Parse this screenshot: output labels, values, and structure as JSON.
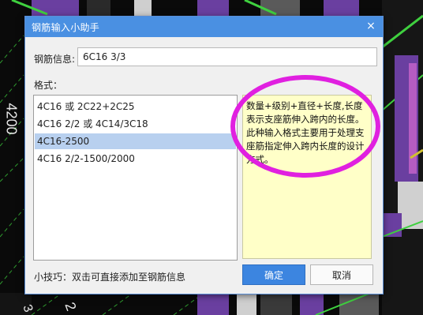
{
  "background": {
    "labels": [
      "4200",
      "2",
      "3"
    ]
  },
  "dialog": {
    "title": "钢筋输入小助手",
    "close_glyph": "×",
    "info_label": "钢筋信息:",
    "info_value": "6C16 3/3",
    "format_label": "格式：",
    "formats": [
      "4C16 或 2C22+2C25",
      "4C16 2/2 或 4C14/3C18",
      "4C16-2500",
      "4C16 2/2-1500/2000"
    ],
    "selected_index": 2,
    "description": "数量+级别+直径+长度,长度表示支座筋伸入跨内的长度。此种输入格式主要用于处理支座筋指定伸入跨内长度的设计方式。",
    "tip": "小技巧：双击可直接添加至钢筋信息",
    "ok_label": "确定",
    "cancel_label": "取消"
  },
  "colors": {
    "title_bar": "#4a90e2",
    "selected_row": "#b8d0ef",
    "description_bg": "#ffffc8",
    "annotation": "#e020e0"
  }
}
